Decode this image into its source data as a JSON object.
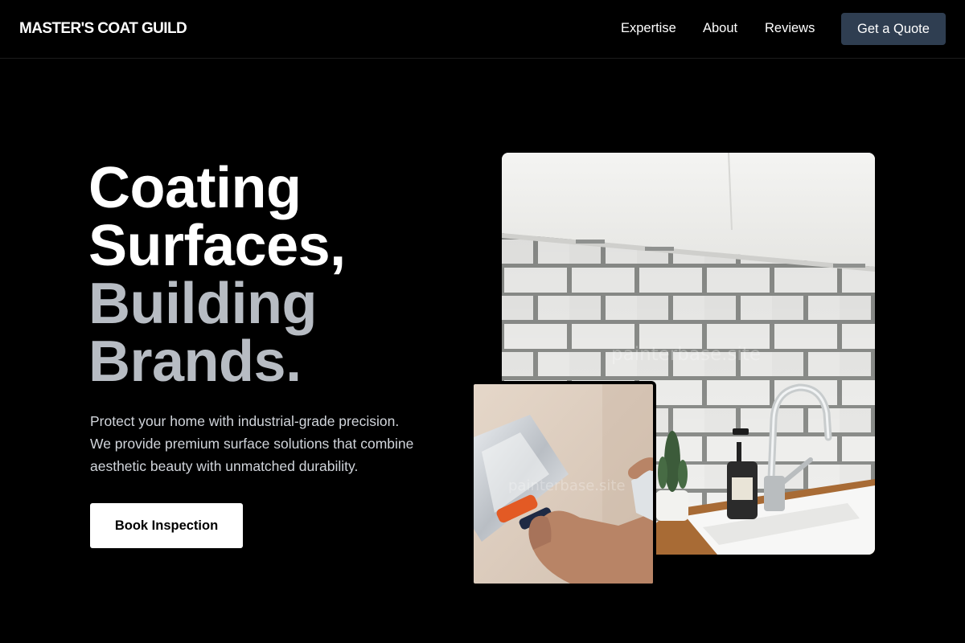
{
  "nav": {
    "brand": "MASTER'S COAT GUILD",
    "links": [
      "Expertise",
      "About",
      "Reviews"
    ],
    "cta": "Get a Quote",
    "cta_color": "#2f3e51"
  },
  "hero": {
    "headline_lines": [
      "Coating",
      "Surfaces,",
      "Building",
      "Brands."
    ],
    "subtext_lines": [
      "Protect your home with industrial-grade precision.",
      "We provide premium surface solutions that combine",
      "aesthetic beauty with unmatched durability."
    ],
    "cta": "Book Inspection"
  },
  "images": {
    "main_watermark": "painterbase.site",
    "small_watermark": "painterbase.site",
    "main_icon": "kitchen-subway-tile-photo",
    "small_icon": "plastering-trowel-photo"
  },
  "colors": {
    "background": "#000000",
    "headline_primary": "#ffffff",
    "headline_secondary": "#b7bcc3",
    "body_text": "#d1d5db"
  }
}
